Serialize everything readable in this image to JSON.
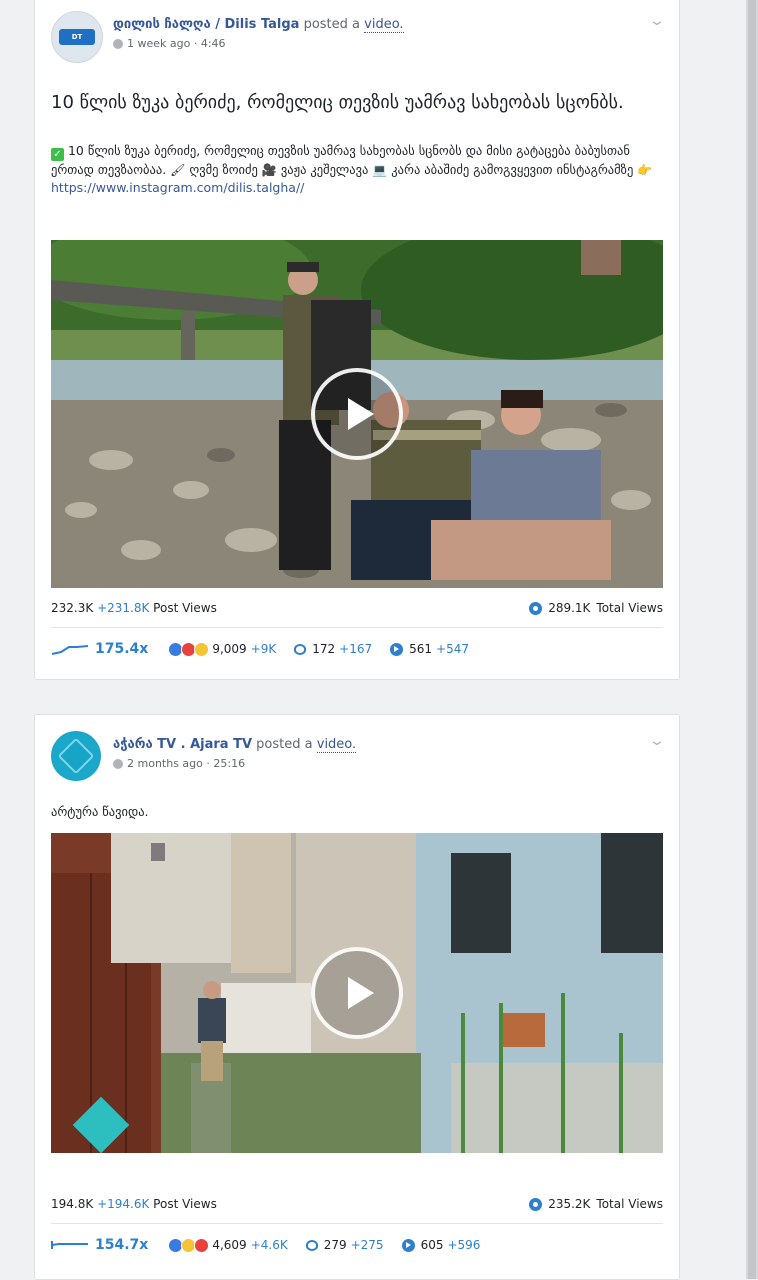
{
  "posts": [
    {
      "page_name": "დილის ჩალღა / Dilis Talga",
      "verb": "posted a",
      "media": "video.",
      "time": "1 week ago · 4:46",
      "title": "10 წლის ზუკა ბერიძე, რომელიც თევზის უამრავ სახეობას სცონბს.",
      "description": "10 წლის ზუკა ბერიძე, რომელიც თევზის უამრავ სახეობას სცნობს და მისი გატაცება ბაბუსთან ერთად თევზაობაა.",
      "desc_tail": "ღვმე ზოიძე",
      "desc_tail2": "ვაჟა კეშელავა",
      "desc_tail3": "კარა აბაშიძე გამოგვყევით ინსტაგრამზე",
      "url": "https://www.instagram.com/dilis.talgha//",
      "post_views": "232.3K",
      "post_views_delta": "+231.8K",
      "post_views_label": "Post Views",
      "total_views": "289.1K",
      "total_views_label": "Total Views",
      "multiplier": "175.4x",
      "reactions": "9,009",
      "reactions_delta": "+9K",
      "comments": "172",
      "comments_delta": "+167",
      "shares": "561",
      "shares_delta": "+547"
    },
    {
      "page_name": "აჭარა TV . Ajara TV",
      "verb": "posted a",
      "media": "video.",
      "time": "2 months ago · 25:16",
      "description": "არტურა წავიდა.",
      "post_views": "194.8K",
      "post_views_delta": "+194.6K",
      "post_views_label": "Post Views",
      "total_views": "235.2K",
      "total_views_label": "Total Views",
      "multiplier": "154.7x",
      "reactions": "4,609",
      "reactions_delta": "+4.6K",
      "comments": "279",
      "comments_delta": "+275",
      "shares": "605",
      "shares_delta": "+596"
    }
  ],
  "icons": {
    "globe": "globe-icon",
    "chevron": "chevron-down-icon",
    "play": "play-icon",
    "views": "total-views-icon",
    "trend": "trend-line-icon",
    "comment": "comment-icon",
    "share": "share-icon"
  },
  "colors": {
    "link": "#365899",
    "accent": "#2d7fd0"
  }
}
